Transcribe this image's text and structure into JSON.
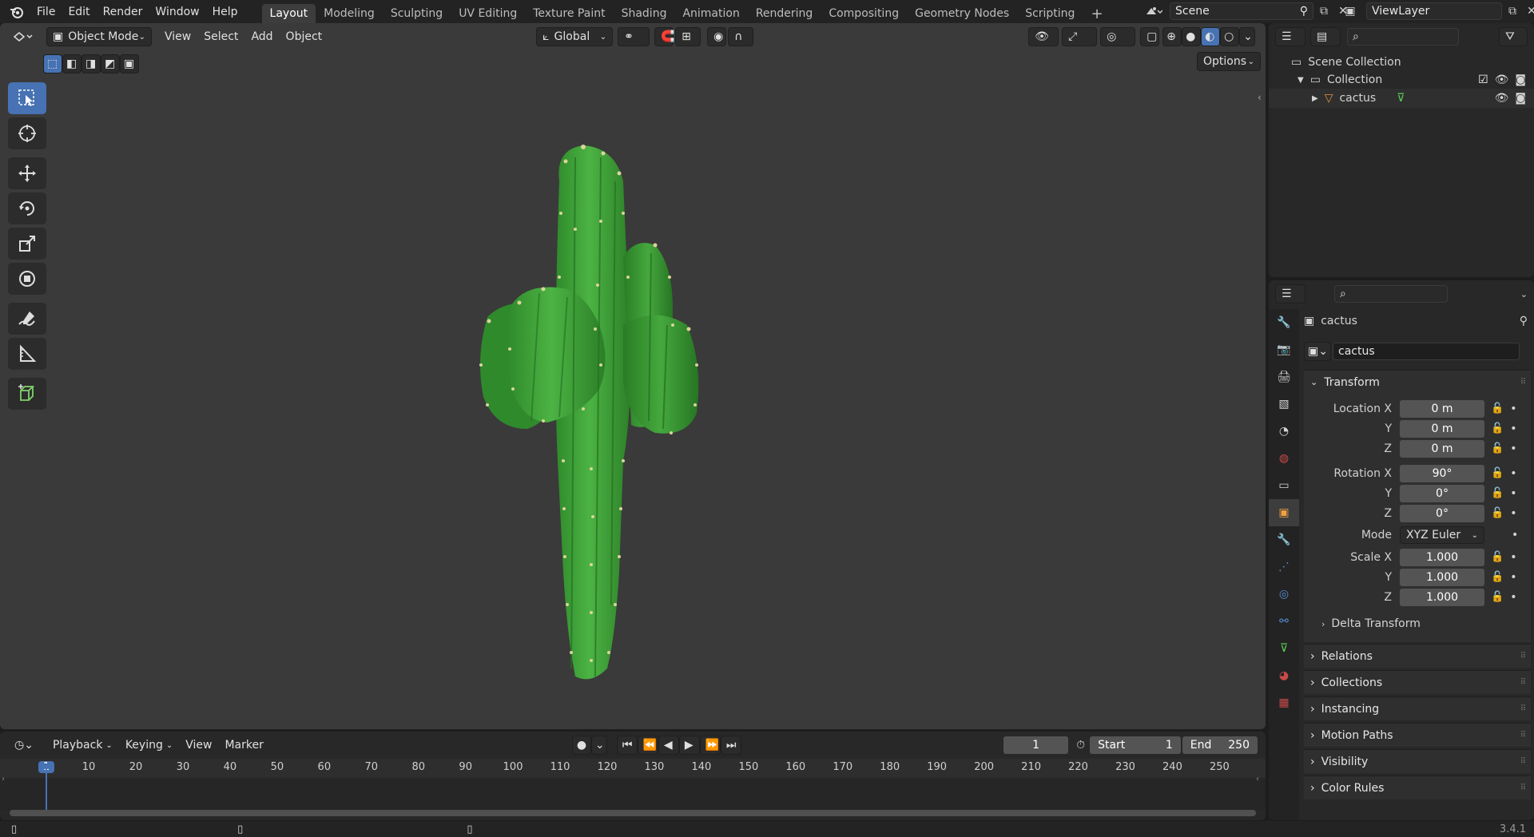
{
  "menubar": {
    "menus": [
      "File",
      "Edit",
      "Render",
      "Window",
      "Help"
    ],
    "workspaces": [
      "Layout",
      "Modeling",
      "Sculpting",
      "UV Editing",
      "Texture Paint",
      "Shading",
      "Animation",
      "Rendering",
      "Compositing",
      "Geometry Nodes",
      "Scripting"
    ],
    "active_workspace": "Layout",
    "add_tab": "+",
    "scene": "Scene",
    "view_layer": "ViewLayer"
  },
  "viewport": {
    "mode": "Object Mode",
    "menus": [
      "View",
      "Select",
      "Add",
      "Object"
    ],
    "orientation": "Global",
    "options": "Options"
  },
  "outliner": {
    "root": "Scene Collection",
    "collection": "Collection",
    "object": "cactus"
  },
  "properties": {
    "object_name": "cactus",
    "datablock_name": "cactus",
    "transform_label": "Transform",
    "location": {
      "label": "Location X",
      "x": "0 m",
      "y": "0 m",
      "z": "0 m"
    },
    "rotation": {
      "label": "Rotation X",
      "x": "90°",
      "y": "0°",
      "z": "0°"
    },
    "mode_label": "Mode",
    "mode_value": "XYZ Euler",
    "scale": {
      "label": "Scale X",
      "x": "1.000",
      "y": "1.000",
      "z": "1.000"
    },
    "axis_y": "Y",
    "axis_z": "Z",
    "delta_transform": "Delta Transform",
    "panels": [
      "Relations",
      "Collections",
      "Instancing",
      "Motion Paths",
      "Visibility",
      "Color Rules"
    ]
  },
  "timeline": {
    "menus": [
      "Playback",
      "Keying",
      "View",
      "Marker"
    ],
    "current_frame": "1",
    "start_label": "Start",
    "start_value": "1",
    "end_label": "End",
    "end_value": "250",
    "ticks": [
      "1",
      "10",
      "20",
      "30",
      "40",
      "50",
      "60",
      "70",
      "80",
      "90",
      "100",
      "110",
      "120",
      "130",
      "140",
      "150",
      "160",
      "170",
      "180",
      "190",
      "200",
      "210",
      "220",
      "230",
      "240",
      "250"
    ]
  },
  "statusbar": {
    "version": "3.4.1"
  },
  "colors": {
    "accent": "#4772b3",
    "cactus": "#3a9a32",
    "active_frame": "#4772b3"
  }
}
